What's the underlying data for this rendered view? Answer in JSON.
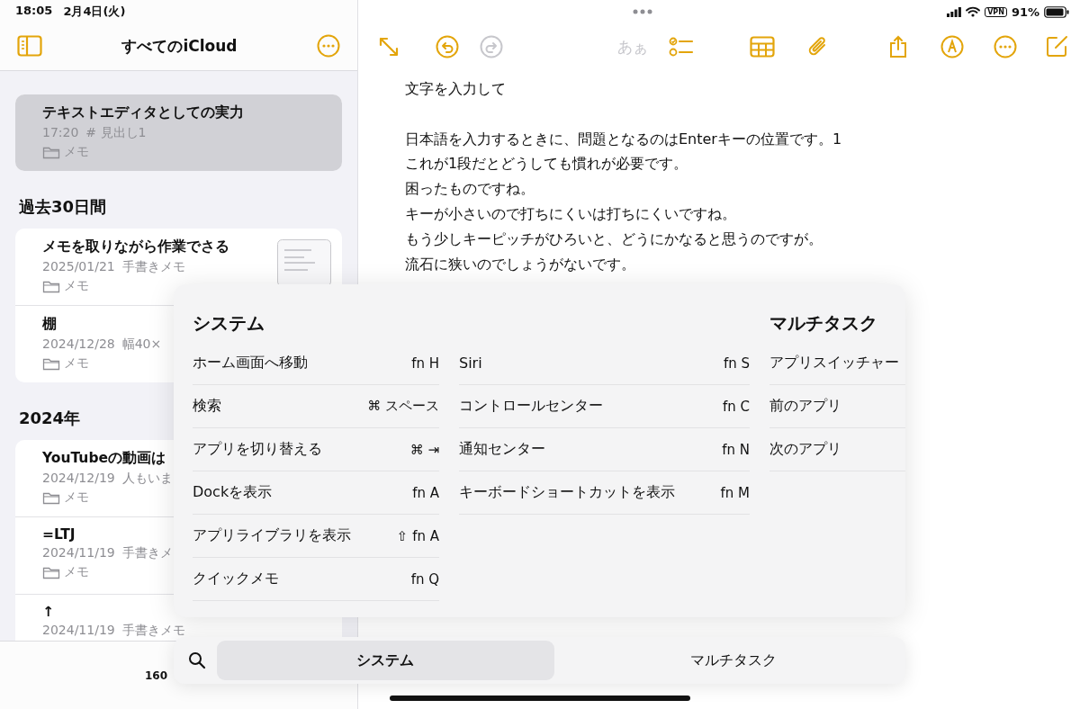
{
  "status_bar": {
    "time": "18:05",
    "date": "2月4日(火)",
    "vpn": "VPN",
    "battery": "91%"
  },
  "sidebar": {
    "title": "すべてのiCloud",
    "footer": "160",
    "sections": [
      {
        "notes": [
          {
            "title": "テキストエディタとしての実力",
            "date": "17:20",
            "detail": "# 見出し1",
            "folder": "メモ",
            "selected": true
          }
        ]
      },
      {
        "heading": "過去30日間",
        "notes": [
          {
            "title": "メモを取りながら作業でさる",
            "date": "2025/01/21",
            "detail": "手書きメモ",
            "folder": "メモ",
            "selected": false
          },
          {
            "title": "棚",
            "date": "2024/12/28",
            "detail": "幅40×",
            "folder": "メモ",
            "selected": false
          }
        ]
      },
      {
        "heading": "2024年",
        "notes": [
          {
            "title": "YouTubeの動画は",
            "date": "2024/12/19",
            "detail": "人もいま",
            "folder": "メモ",
            "selected": false
          },
          {
            "title": "=LTJ",
            "date": "2024/11/19",
            "detail": "手書きメ",
            "folder": "メモ",
            "selected": false
          },
          {
            "title": "↑",
            "date": "2024/11/19",
            "detail": "手書きメモ",
            "selected": false
          }
        ]
      }
    ]
  },
  "toolbar": [
    {
      "kind": "expand",
      "disabled": false
    },
    {
      "kind": "undo",
      "disabled": false
    },
    {
      "kind": "redo",
      "disabled": true
    },
    {
      "kind": "text-style",
      "label": "あぁ",
      "disabled": true
    },
    {
      "kind": "checklist",
      "disabled": false
    },
    {
      "kind": "table",
      "disabled": false
    },
    {
      "kind": "attach",
      "disabled": false
    },
    {
      "kind": "share",
      "disabled": false
    },
    {
      "kind": "markup",
      "disabled": false
    },
    {
      "kind": "more",
      "disabled": false
    },
    {
      "kind": "compose",
      "disabled": false
    }
  ],
  "editor": {
    "paragraphs": [
      {
        "lines": [
          "文字を入力して"
        ]
      },
      {
        "lines": [
          "日本語を入力するときに、問題となるのはEnterキーの位置です。1",
          "これが1段だとどうしても慣れが必要です。",
          "困ったものですね。",
          "キーが小さいので打ちにくいは打ちにくいですね。",
          "もう少しキーピッチがひろいと、どうにかなると思うのですが。",
          "流石に狭いのでしょうがないです。"
        ]
      }
    ]
  },
  "shortcut_panel": {
    "columns": [
      {
        "heading": "システム",
        "items": [
          {
            "label": "ホーム画面へ移動",
            "key": "fn H"
          },
          {
            "label": "検索",
            "key": "⌘ スペース"
          },
          {
            "label": "アプリを切り替える",
            "key": "⌘ ⇥"
          },
          {
            "label": "Dockを表示",
            "key": "fn A"
          },
          {
            "label": "アプリライブラリを表示",
            "key": "⇧ fn A"
          },
          {
            "label": "クイックメモ",
            "key": "fn Q"
          }
        ]
      },
      {
        "items": [
          {
            "label": "Siri",
            "key": "fn S"
          },
          {
            "label": "コントロールセンター",
            "key": "fn C"
          },
          {
            "label": "通知センター",
            "key": "fn N"
          },
          {
            "label": "キーボードショートカットを表示",
            "key": "fn M"
          }
        ]
      },
      {
        "heading": "マルチタスク",
        "items": [
          {
            "label": "アプリスイッチャー"
          },
          {
            "label": "前のアプリ"
          },
          {
            "label": "次のアプリ"
          }
        ]
      }
    ],
    "tabs": [
      {
        "label": "システム",
        "selected": true
      },
      {
        "label": "マルチタスク",
        "selected": false
      }
    ]
  }
}
